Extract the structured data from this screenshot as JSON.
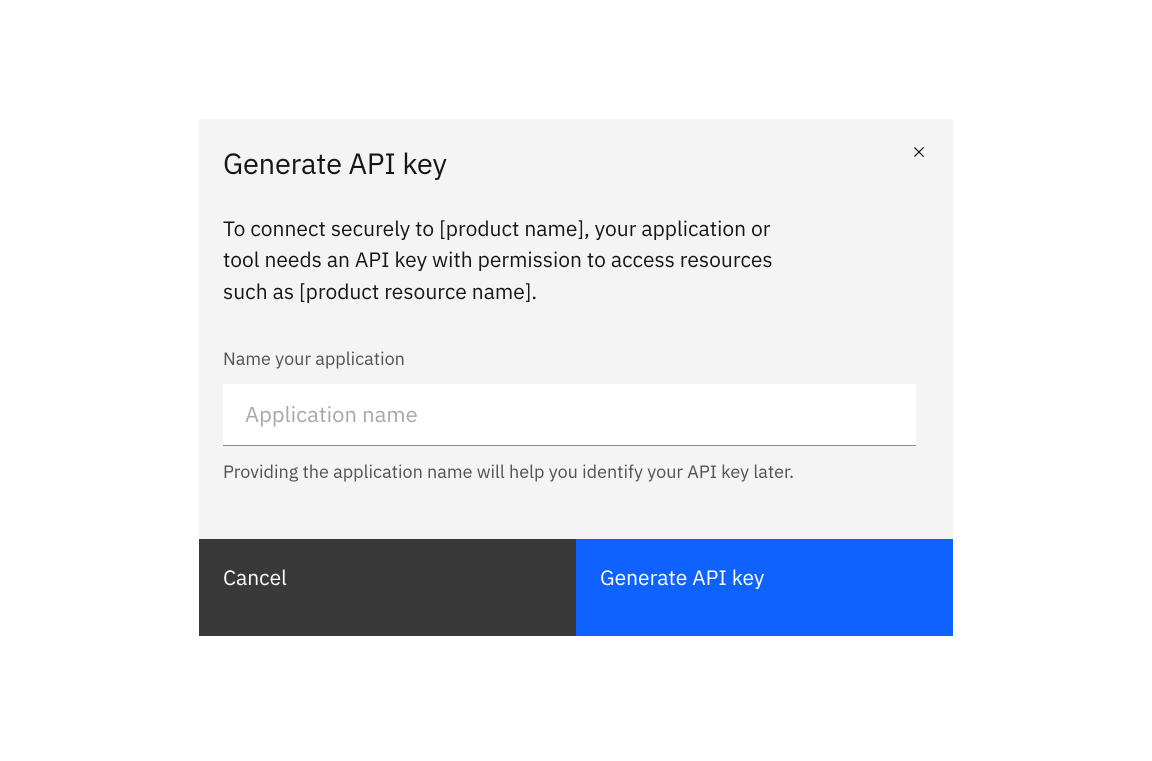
{
  "modal": {
    "title": "Generate API key",
    "description": "To connect securely to [product name], your application or tool needs an API key with permission to access resources such as [product resource name].",
    "field_label": "Name your application",
    "input_placeholder": "Application name",
    "input_value": "",
    "helper_text": "Providing the application name will help you identify your API key later.",
    "cancel_label": "Cancel",
    "submit_label": "Generate API key"
  }
}
